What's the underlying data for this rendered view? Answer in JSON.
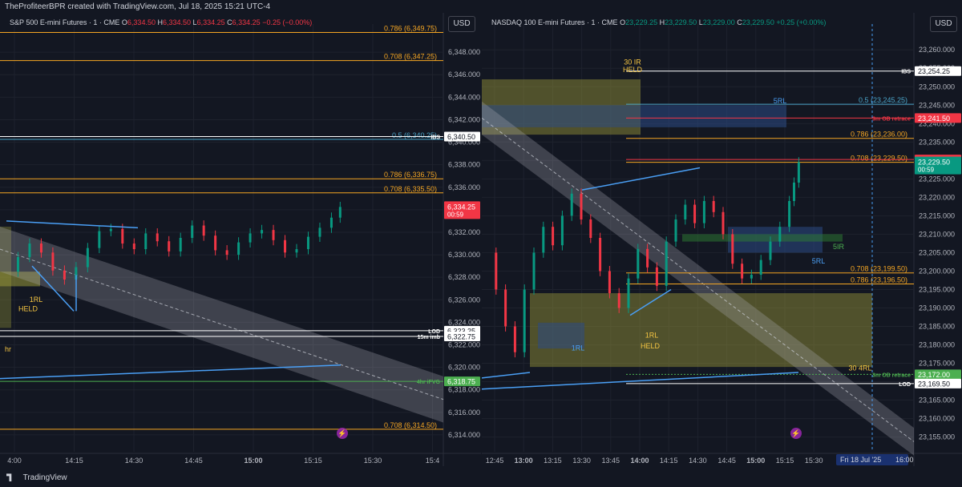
{
  "header": {
    "caption": "TheProfiteerBPR created with TradingView.com, Jul 18, 2025 15:21 UTC-4"
  },
  "footer": {
    "brand": "TradingView"
  },
  "currency_button": "USD",
  "left": {
    "legend": {
      "symbol": "S&P 500 E-mini Futures · 1 · CME",
      "o": "6,334.50",
      "h": "6,334.50",
      "l": "6,334.25",
      "c": "6,334.25",
      "chg": "−0.25 (−0.00%)"
    }
  },
  "right": {
    "legend": {
      "symbol": "NASDAQ 100 E-mini Futures · 1 · CME",
      "o": "23,229.25",
      "h": "23,229.50",
      "l": "23,229.00",
      "c": "23,229.50",
      "chg": "+0.25 (+0.00%)"
    }
  },
  "chart_data": [
    {
      "type": "line",
      "title": "S&P 500 E-mini Futures · 1 · CME",
      "ylim": [
        6312.5,
        6350.5
      ],
      "y_ticks": [
        6314,
        6316,
        6318,
        6320,
        6322,
        6324,
        6326,
        6328,
        6330,
        6332,
        6334,
        6336,
        6338,
        6340,
        6342,
        6344,
        6346,
        6348
      ],
      "x_ticks": [
        "4:00",
        "14:15",
        "14:30",
        "14:45",
        "15:00",
        "15:15",
        "15:30",
        "15:4"
      ],
      "last_price": "6,334.25",
      "countdown": "00:59",
      "close_path": [
        [
          0,
          6328.5
        ],
        [
          4,
          6329.8
        ],
        [
          8,
          6331.0
        ],
        [
          12,
          6330.2
        ],
        [
          16,
          6328.6
        ],
        [
          20,
          6327.8
        ],
        [
          24,
          6328.9
        ],
        [
          28,
          6330.6
        ],
        [
          32,
          6332.1
        ],
        [
          36,
          6332.3
        ],
        [
          40,
          6331.0
        ],
        [
          44,
          6330.5
        ],
        [
          48,
          6331.9
        ],
        [
          52,
          6331.2
        ],
        [
          56,
          6330.3
        ],
        [
          60,
          6331.5
        ],
        [
          64,
          6332.6
        ],
        [
          68,
          6331.7
        ],
        [
          72,
          6330.4
        ],
        [
          76,
          6330.0
        ],
        [
          80,
          6331.1
        ],
        [
          84,
          6331.9
        ],
        [
          88,
          6332.2
        ],
        [
          92,
          6331.3
        ],
        [
          96,
          6330.2
        ],
        [
          100,
          6330.5
        ],
        [
          104,
          6331.6
        ],
        [
          108,
          6332.4
        ],
        [
          112,
          6333.3
        ],
        [
          115,
          6334.25
        ]
      ],
      "levels": [
        {
          "label": "0.786 (6,349.75)",
          "value": 6349.75,
          "color": "#f5a623"
        },
        {
          "label": "0.708 (6,347.25)",
          "value": 6347.25,
          "color": "#f5a623"
        },
        {
          "label": "0.5 (6,340.25)",
          "value": 6340.25,
          "color": "#4aa3c7"
        },
        {
          "label": "0.786 (6,336.75)",
          "value": 6336.75,
          "color": "#f5a623"
        },
        {
          "label": "0.708 (6,335.50)",
          "value": 6335.5,
          "color": "#f5a623"
        },
        {
          "label": "0.708 (6,314.50)",
          "value": 6314.5,
          "color": "#f5a623"
        }
      ],
      "marked_levels": [
        {
          "name": "IBS",
          "value": 6340.5,
          "value_label": "6,340.50",
          "color": "#ffffff"
        },
        {
          "name": "LOD",
          "value": 6323.25,
          "value_label": "6,323.25",
          "color": "#ffffff"
        },
        {
          "name": "15m imb",
          "value": 6322.75,
          "value_label": "6,322.75",
          "color": "#ffffff"
        },
        {
          "name": "4hr iFVG",
          "value": 6318.75,
          "value_label": "6,318.75",
          "color": "#4caf50"
        }
      ],
      "annotations": [
        "1RL",
        "HELD",
        "hr"
      ]
    },
    {
      "type": "line",
      "title": "NASDAQ 100 E-mini Futures · 1 · CME",
      "ylim": [
        23151,
        23267
      ],
      "y_ticks": [
        23155,
        23160,
        23165,
        23170,
        23175,
        23180,
        23185,
        23190,
        23195,
        23200,
        23205,
        23210,
        23215,
        23220,
        23225,
        23230,
        23235,
        23240,
        23245,
        23250,
        23255,
        23260
      ],
      "x_ticks": [
        "12:45",
        "13:00",
        "13:15",
        "13:30",
        "13:45",
        "14:00",
        "14:15",
        "14:30",
        "14:45",
        "15:00",
        "15:15",
        "15:30"
      ],
      "time_label": "Fri 18 Jul '25",
      "time_label_2": "16:00",
      "last_price": "23,229.50",
      "countdown": "00:59",
      "close_path": [
        [
          0,
          23205
        ],
        [
          4,
          23195
        ],
        [
          8,
          23185
        ],
        [
          12,
          23178
        ],
        [
          16,
          23195
        ],
        [
          20,
          23205
        ],
        [
          24,
          23212
        ],
        [
          28,
          23207
        ],
        [
          32,
          23215
        ],
        [
          36,
          23221
        ],
        [
          40,
          23214
        ],
        [
          44,
          23209
        ],
        [
          48,
          23200
        ],
        [
          52,
          23194
        ],
        [
          56,
          23190
        ],
        [
          60,
          23198
        ],
        [
          64,
          23206
        ],
        [
          68,
          23201
        ],
        [
          72,
          23196
        ],
        [
          76,
          23208
        ],
        [
          80,
          23214
        ],
        [
          84,
          23218
        ],
        [
          88,
          23213
        ],
        [
          92,
          23219
        ],
        [
          96,
          23216
        ],
        [
          100,
          23210
        ],
        [
          104,
          23202
        ],
        [
          108,
          23198
        ],
        [
          112,
          23199
        ],
        [
          116,
          23203
        ],
        [
          120,
          23208
        ],
        [
          124,
          23212
        ],
        [
          128,
          23219
        ],
        [
          130,
          23224
        ],
        [
          132,
          23229.5
        ]
      ],
      "levels": [
        {
          "label": "0.5 (23,245.25)",
          "value": 23245.25,
          "color": "#4aa3c7"
        },
        {
          "label": "0.786 (23,236.00)",
          "value": 23236.0,
          "color": "#f5a623"
        },
        {
          "label": "0.708 (23,229.50)",
          "value": 23229.5,
          "color": "#f5a623"
        },
        {
          "label": "0.708 (23,199.50)",
          "value": 23199.5,
          "color": "#f5a623"
        },
        {
          "label": "0.786 (23,196.50)",
          "value": 23196.5,
          "color": "#f5a623"
        }
      ],
      "marked_levels": [
        {
          "name": "IBS",
          "value": 23254.25,
          "value_label": "23,254.25",
          "color": "#ffffff"
        },
        {
          "name": "3m OB retrace",
          "value": 23241.5,
          "value_label": "23,241.50",
          "color": "#f23645"
        },
        {
          "name": "",
          "value": 23230.25,
          "value_label": "23,230.25",
          "color": "#f23645"
        },
        {
          "name": "3m OB retrace",
          "value": 23172.0,
          "value_label": "23,172.00",
          "color": "#4caf50"
        },
        {
          "name": "LOD",
          "value": 23169.5,
          "value_label": "23,169.50",
          "color": "#ffffff"
        }
      ],
      "annotations": [
        "30 IR",
        "HELD",
        "5RL",
        "5IR",
        "5RL",
        "1RL",
        "1RL",
        "HELD",
        "30 4RL"
      ]
    }
  ]
}
